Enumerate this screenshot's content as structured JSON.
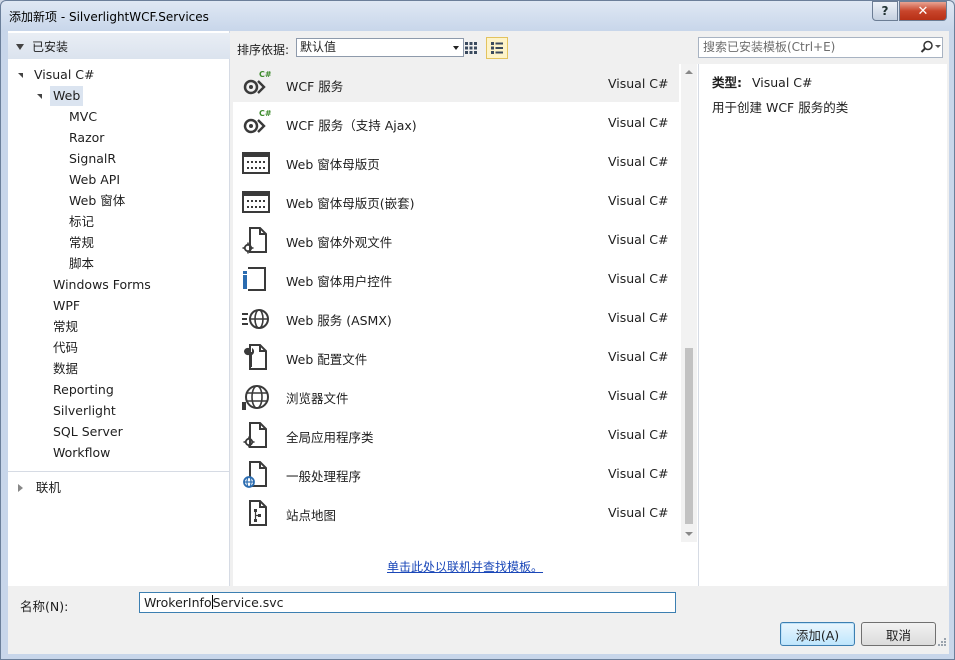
{
  "window": {
    "title": "添加新项 - SilverlightWCF.Services",
    "help_label": "?",
    "close_label": "✕"
  },
  "left": {
    "header": "已安装",
    "tree": [
      {
        "label": "Visual C#",
        "level": 0,
        "expander": "expanded"
      },
      {
        "label": "Web",
        "level": 1,
        "expander": "expanded",
        "selected": true
      },
      {
        "label": "MVC",
        "level": 2
      },
      {
        "label": "Razor",
        "level": 2
      },
      {
        "label": "SignalR",
        "level": 2
      },
      {
        "label": "Web API",
        "level": 2
      },
      {
        "label": "Web 窗体",
        "level": 2
      },
      {
        "label": "标记",
        "level": 2
      },
      {
        "label": "常规",
        "level": 2
      },
      {
        "label": "脚本",
        "level": 2
      },
      {
        "label": "Windows Forms",
        "level": 1
      },
      {
        "label": "WPF",
        "level": 1
      },
      {
        "label": "常规",
        "level": 1
      },
      {
        "label": "代码",
        "level": 1
      },
      {
        "label": "数据",
        "level": 1
      },
      {
        "label": "Reporting",
        "level": 1
      },
      {
        "label": "Silverlight",
        "level": 1
      },
      {
        "label": "SQL Server",
        "level": 1
      },
      {
        "label": "Workflow",
        "level": 1
      }
    ],
    "online": "联机"
  },
  "toolbar": {
    "sort_label": "排序依据:",
    "sort_value": "默认值",
    "search_placeholder": "搜索已安装模板(Ctrl+E)"
  },
  "items": [
    {
      "name": "WCF 服务",
      "lang": "Visual C#",
      "icon": "wcf-service-icon",
      "selected": true
    },
    {
      "name": "WCF 服务（支持 Ajax)",
      "lang": "Visual C#",
      "icon": "wcf-ajax-service-icon"
    },
    {
      "name": "Web 窗体母版页",
      "lang": "Visual C#",
      "icon": "master-page-icon"
    },
    {
      "name": "Web 窗体母版页(嵌套)",
      "lang": "Visual C#",
      "icon": "nested-master-page-icon"
    },
    {
      "name": "Web 窗体外观文件",
      "lang": "Visual C#",
      "icon": "skin-file-icon"
    },
    {
      "name": "Web 窗体用户控件",
      "lang": "Visual C#",
      "icon": "user-control-icon"
    },
    {
      "name": "Web 服务 (ASMX)",
      "lang": "Visual C#",
      "icon": "web-service-icon"
    },
    {
      "name": "Web 配置文件",
      "lang": "Visual C#",
      "icon": "web-config-icon"
    },
    {
      "name": "浏览器文件",
      "lang": "Visual C#",
      "icon": "browser-file-icon"
    },
    {
      "name": "全局应用程序类",
      "lang": "Visual C#",
      "icon": "global-app-class-icon"
    },
    {
      "name": "一般处理程序",
      "lang": "Visual C#",
      "icon": "generic-handler-icon"
    },
    {
      "name": "站点地图",
      "lang": "Visual C#",
      "icon": "site-map-icon"
    }
  ],
  "online_link": "单击此处以联机并查找模板。",
  "details": {
    "type_key": "类型:",
    "type_value": "Visual C#",
    "description": "用于创建 WCF 服务的类"
  },
  "footer": {
    "name_label": "名称(N):",
    "name_value_before_caret": "WrokerInfo",
    "name_value_after_caret": "Service.svc",
    "add_label": "添加(A)",
    "cancel_label": "取消"
  },
  "colors": {
    "accent": "#3c7fb1",
    "link": "#1a47b8",
    "icon_dark": "#3a3a3a",
    "icon_green": "#3d8b2c",
    "icon_blue": "#2b6cb0"
  }
}
